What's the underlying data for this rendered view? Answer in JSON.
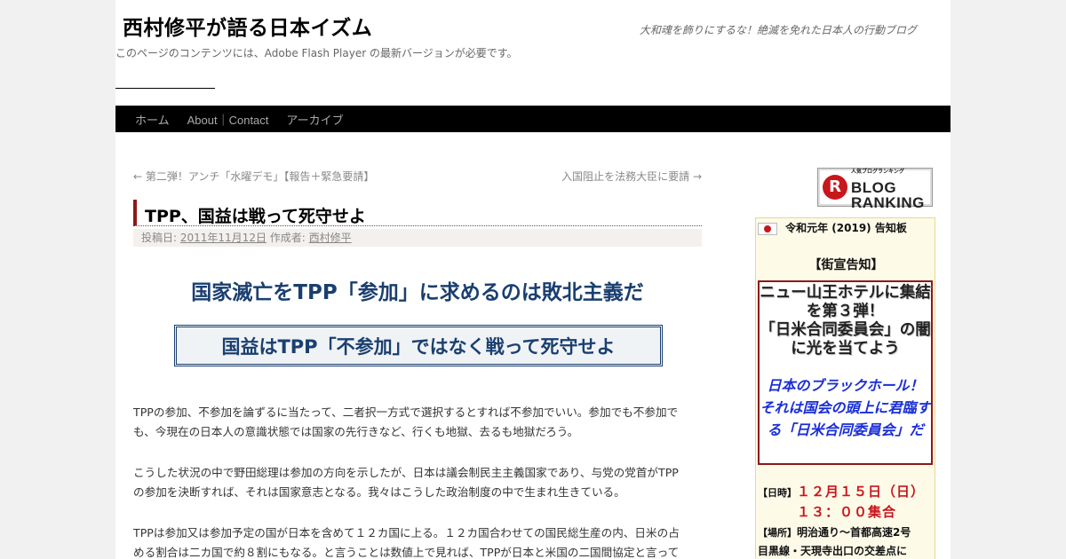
{
  "site": {
    "title": "西村修平が語る日本イズム",
    "description": "大和魂を飾りにするな！絶滅を免れた日本人の行動ブログ",
    "flash_note": "このページのコンテンツには、Adobe Flash Player の最新バージョンが必要です。"
  },
  "nav": {
    "items": [
      "ホーム",
      "About｜Contact",
      "アーカイブ"
    ]
  },
  "post_nav": {
    "prev": "← 第二弾！アンチ「水曜デモ」【報告＋緊急要請】",
    "next": "入国阻止を法務大臣に要請 →"
  },
  "post": {
    "title": "TPP、国益は戦って死守せよ",
    "meta": {
      "posted_on_label": "投稿日:",
      "date": "2011年11月12日",
      "author_label": "作成者:",
      "author": "西村修平"
    },
    "headline1": "国家滅亡をTPP「参加」に求めるのは敗北主義だ",
    "headline2": "国益はTPP「不参加」ではなく戦って死守せよ",
    "paragraphs": [
      [
        "TPPの参加、不参加を論ずるに当たって、二者択一方式で選択するとすれば不参加でいい。参加でも不参加で",
        "も、今現在の日本人の意識状態では国家の先行きなど、行くも地獄、去るも地獄だろう。"
      ],
      [
        "こうした状況の中で野田総理は参加の方向を示したが、日本は議会制民主主義国家であり、与党の党首がTPP",
        "の参加を決断すれば、それは国家意志となる。我々はこうした政治制度の中で生まれ生きている。"
      ],
      [
        "TPPは参加又は参加予定の国が日本を含めて１２カ国に上る。１２カ国合わせての国民総生産の内、日米の占",
        "める割合は二カ国で約８割にもなる。と言うことは数値上で見れば、TPPが日本と米国の二国間協定と言って"
      ]
    ]
  },
  "sidebar": {
    "ranking_button": {
      "main": "BLOG\nRANKING",
      "small": "人気ブログランキング",
      "logo": "R"
    },
    "notice": {
      "title": "令和元年 (2019) 告知板",
      "subtitle": "【街宣告知】",
      "main": "ニュー山王ホテルに集結を第３弾！\n「日米合同委員会」の闇に光を当てよう",
      "emphasis": "日本のブラックホール！\nそれは国会の頭上に君臨する「日米合同委員会」だ",
      "date_label": "【日時】",
      "date": "１２月１５日（日）",
      "time": "１３：００集合",
      "place_label": "【場所】",
      "place1": "明治通り～首都高速2号",
      "place2": "目黒線・天現寺出口の交差点に"
    }
  },
  "colors": {
    "nav_bg": "#000000",
    "title_accent": "#8b1a1a",
    "headline": "#1a3f6f",
    "emphasis": "#1a2fd6",
    "date_red": "#c8161d"
  }
}
